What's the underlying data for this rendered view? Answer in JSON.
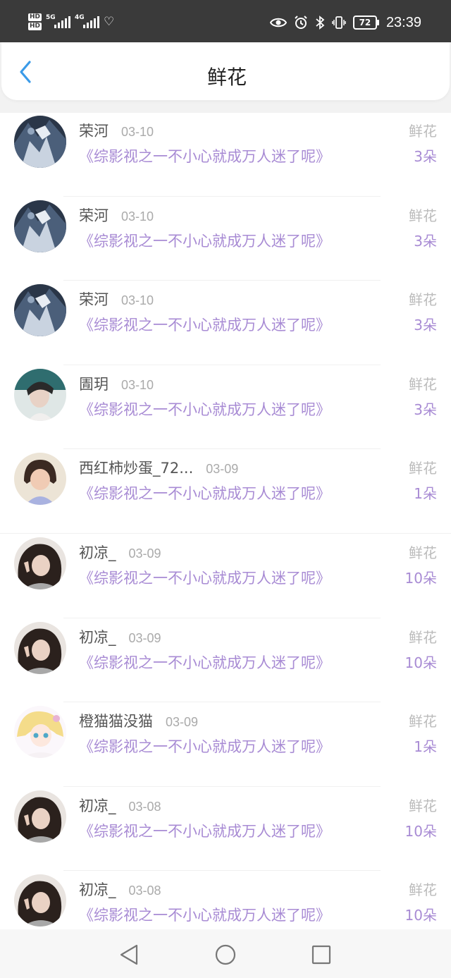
{
  "status_bar": {
    "hd1": "HD",
    "hd2": "HD",
    "sig1": "5G",
    "sig2": "4G",
    "battery": "72",
    "time": "23:39"
  },
  "header": {
    "title": "鲜花"
  },
  "list": [
    {
      "name": "荣河",
      "date": "03-10",
      "book": "《综影视之一不小心就成万人迷了呢》",
      "label": "鲜花",
      "count": "3朵",
      "avatar": "anime-dark"
    },
    {
      "name": "荣河",
      "date": "03-10",
      "book": "《综影视之一不小心就成万人迷了呢》",
      "label": "鲜花",
      "count": "3朵",
      "avatar": "anime-dark"
    },
    {
      "name": "荣河",
      "date": "03-10",
      "book": "《综影视之一不小心就成万人迷了呢》",
      "label": "鲜花",
      "count": "3朵",
      "avatar": "anime-dark"
    },
    {
      "name": "圊玥",
      "date": "03-10",
      "book": "《综影视之一不小心就成万人迷了呢》",
      "label": "鲜花",
      "count": "3朵",
      "avatar": "woman-teal"
    },
    {
      "name": "西红柿炒蛋_72...",
      "date": "03-09",
      "book": "《综影视之一不小心就成万人迷了呢》",
      "label": "鲜花",
      "count": "1朵",
      "avatar": "child"
    },
    {
      "name": "初凉_",
      "date": "03-09",
      "book": "《综影视之一不小心就成万人迷了呢》",
      "label": "鲜花",
      "count": "10朵",
      "avatar": "girl-curly"
    },
    {
      "name": "初凉_",
      "date": "03-09",
      "book": "《综影视之一不小心就成万人迷了呢》",
      "label": "鲜花",
      "count": "10朵",
      "avatar": "girl-curly"
    },
    {
      "name": "橙猫猫没猫",
      "date": "03-09",
      "book": "《综影视之一不小心就成万人迷了呢》",
      "label": "鲜花",
      "count": "1朵",
      "avatar": "anime-blonde"
    },
    {
      "name": "初凉_",
      "date": "03-08",
      "book": "《综影视之一不小心就成万人迷了呢》",
      "label": "鲜花",
      "count": "10朵",
      "avatar": "girl-curly"
    },
    {
      "name": "初凉_",
      "date": "03-08",
      "book": "《综影视之一不小心就成万人迷了呢》",
      "label": "鲜花",
      "count": "10朵",
      "avatar": "girl-curly"
    }
  ],
  "nav": {
    "back": "back-triangle-icon",
    "home": "home-circle-icon",
    "recents": "recents-square-icon"
  }
}
